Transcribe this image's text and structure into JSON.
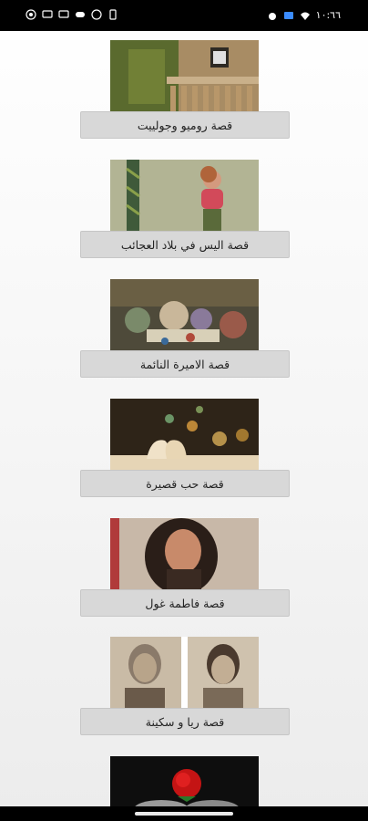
{
  "status_bar": {
    "time": "١٠:٦٦",
    "left_icons": [
      "whatsapp-icon",
      "chat-icon",
      "chat-icon",
      "gamepad-icon",
      "messenger-icon",
      "phone-icon"
    ],
    "right_icons": [
      "alarm-icon",
      "cast-icon",
      "wifi-icon"
    ]
  },
  "stories": [
    {
      "title": "قصة روميو وجولييت",
      "image": "balcony-photo"
    },
    {
      "title": "قصة اليس في بلاد العجائب",
      "image": "girl-photo"
    },
    {
      "title": "قصة الاميرة النائمة",
      "image": "painting-photo"
    },
    {
      "title": "قصة حب قصيرة",
      "image": "book-heart-photo"
    },
    {
      "title": "قصة فاطمة غول",
      "image": "woman-portrait-photo"
    },
    {
      "title": "قصة ريا و سكينة",
      "image": "sisters-portrait-photo"
    },
    {
      "title": "",
      "image": "red-rose-photo"
    }
  ]
}
